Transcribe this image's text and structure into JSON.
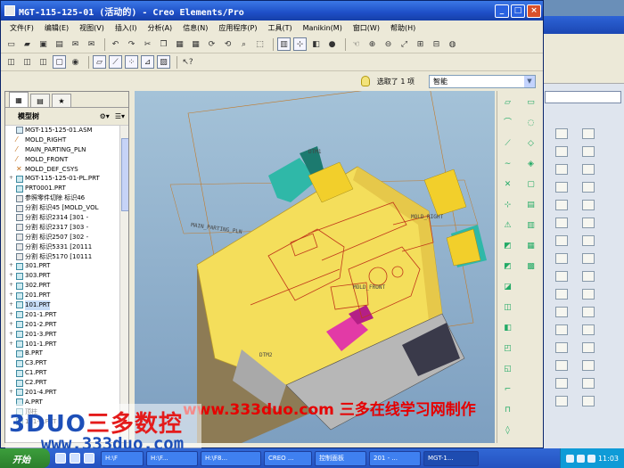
{
  "window": {
    "title": "MGT-115-125-01 (活动的) - Creo Elements/Pro",
    "minimize": "_",
    "maximize": "□",
    "close": "×"
  },
  "menu": [
    "文件(F)",
    "编辑(E)",
    "视图(V)",
    "插入(I)",
    "分析(A)",
    "信息(N)",
    "应用程序(P)",
    "工具(T)",
    "Manikin(M)",
    "窗口(W)",
    "帮助(H)"
  ],
  "selection": {
    "status": "选取了 1 项",
    "filter": "智能"
  },
  "model_tree": {
    "title": "模型树",
    "items": [
      {
        "label": "MGT-115-125-01.ASM",
        "icon": "assembly-icon",
        "expander": ""
      },
      {
        "label": "MOLD_RIGHT",
        "icon": "datum-plane-icon",
        "expander": ""
      },
      {
        "label": "MAIN_PARTING_PLN",
        "icon": "datum-plane-icon",
        "expander": ""
      },
      {
        "label": "MOLD_FRONT",
        "icon": "datum-plane-icon",
        "expander": ""
      },
      {
        "label": "MOLD_DEF_CSYS",
        "icon": "csys-icon",
        "expander": ""
      },
      {
        "label": "MGT-115-125-01-PL.PRT",
        "icon": "part-icon",
        "expander": "+"
      },
      {
        "label": "PRT0001.PRT",
        "icon": "part-icon",
        "expander": ""
      },
      {
        "label": "参照零件切除 标识46",
        "icon": "feature-icon",
        "expander": ""
      },
      {
        "label": "分割 标识45 [MOLD_VOL",
        "icon": "feature-icon",
        "expander": ""
      },
      {
        "label": "分割 标识2314 [301 -",
        "icon": "feature-icon",
        "expander": ""
      },
      {
        "label": "分割 标识2317 [303 -",
        "icon": "feature-icon",
        "expander": ""
      },
      {
        "label": "分割 标识2507 [302 -",
        "icon": "feature-icon",
        "expander": ""
      },
      {
        "label": "分割 标识5331 [20111",
        "icon": "feature-icon",
        "expander": ""
      },
      {
        "label": "分割 标识5170 [10111",
        "icon": "feature-icon",
        "expander": ""
      },
      {
        "label": "301.PRT",
        "icon": "part-icon",
        "expander": "+"
      },
      {
        "label": "303.PRT",
        "icon": "part-icon",
        "expander": "+"
      },
      {
        "label": "302.PRT",
        "icon": "part-icon",
        "expander": "+"
      },
      {
        "label": "201.PRT",
        "icon": "part-icon",
        "expander": "+"
      },
      {
        "label": "101.PRT",
        "icon": "part-icon",
        "expander": "+",
        "highlight": true
      },
      {
        "label": "201-1.PRT",
        "icon": "part-icon",
        "expander": "+"
      },
      {
        "label": "201-2.PRT",
        "icon": "part-icon",
        "expander": "+"
      },
      {
        "label": "201-3.PRT",
        "icon": "part-icon",
        "expander": "+"
      },
      {
        "label": "101-1.PRT",
        "icon": "part-icon",
        "expander": "+"
      },
      {
        "label": "B.PRT",
        "icon": "part-icon",
        "expander": ""
      },
      {
        "label": "C3.PRT",
        "icon": "part-icon",
        "expander": ""
      },
      {
        "label": "C1.PRT",
        "icon": "part-icon",
        "expander": ""
      },
      {
        "label": "C2.PRT",
        "icon": "part-icon",
        "expander": ""
      },
      {
        "label": "201-4.PRT",
        "icon": "part-icon",
        "expander": "+"
      },
      {
        "label": "A.PRT",
        "icon": "part-icon",
        "expander": ""
      },
      {
        "label": "顶柱",
        "icon": "part-icon",
        "expander": ""
      },
      {
        "label": "101-2.PRT",
        "icon": "part-icon",
        "expander": ""
      }
    ]
  },
  "viewport_labels": {
    "dtm1": "DTM1",
    "main_parting": "MAIN_PARTING_PLN",
    "mold_right": "MOLD_RIGHT",
    "mold_front": "MOLD_FRONT",
    "dtm2": "DTM2"
  },
  "watermark": "www.333duo.com  三多在线学习网制作",
  "logo": {
    "brand_a": "3DUO",
    "brand_b": "三多数控",
    "url": "www.333duo.com"
  },
  "taskbar": {
    "start": "开始",
    "tasks": [
      "H:\\F",
      "H:\\F...",
      "H:\\F8...",
      "CREO ...",
      "控制面板",
      "201 - ...",
      "MGT-1..."
    ],
    "clock": "11:03"
  },
  "colors": {
    "part_yellow": "#f6e35c",
    "teal": "#2fb8a8",
    "selected_magenta": "#e23aa6",
    "viewport_bg": "#9db9d2"
  }
}
